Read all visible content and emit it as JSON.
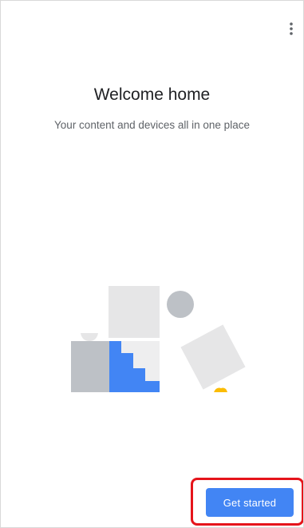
{
  "header": {
    "menu_icon": "more-vert-icon"
  },
  "welcome": {
    "title": "Welcome home",
    "subtitle": "Your content and devices all in one place"
  },
  "illustration": {
    "description_icons": [
      "frame-square",
      "circle",
      "cabinet",
      "staircase",
      "tilted-square",
      "lamp"
    ],
    "colors": {
      "light_gray": "#e6e6e7",
      "mid_gray": "#bdc1c6",
      "blue": "#4285f4",
      "yellow": "#fbbc04"
    }
  },
  "actions": {
    "get_started_label": "Get started",
    "highlight_color": "#e5141b",
    "button_color": "#4285f4"
  }
}
